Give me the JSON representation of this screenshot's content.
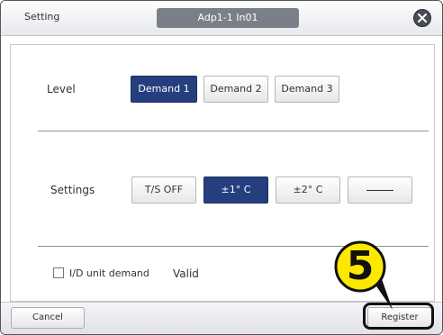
{
  "window": {
    "title": "Setting",
    "unit_name": "Adp1-1 In01",
    "close_icon": "close-circle-icon"
  },
  "level": {
    "label": "Level",
    "options": [
      "Demand 1",
      "Demand 2",
      "Demand 3"
    ],
    "selected": "Demand 1"
  },
  "settings": {
    "label": "Settings",
    "options": [
      "T/S OFF",
      "±1° C",
      "±2° C",
      ""
    ],
    "selected": "±1° C"
  },
  "id_demand": {
    "checkbox_label": "I/D unit demand",
    "checked": false,
    "value": "Valid"
  },
  "footer": {
    "cancel_label": "Cancel",
    "register_label": "Register"
  },
  "annotation": {
    "step_number": "5"
  },
  "colors": {
    "selected_button": "#253f7e",
    "callout_fill": "#ffe800"
  }
}
